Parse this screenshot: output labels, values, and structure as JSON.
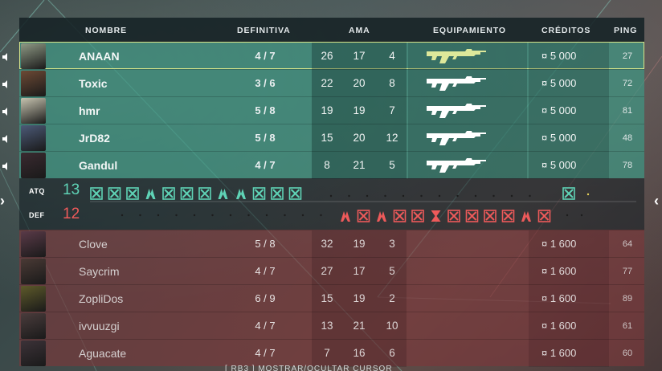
{
  "header": {
    "name": "NOMBRE",
    "ultimate": "DEFINITIVA",
    "kda": "AMA",
    "equipment": "EQUIPAMIENTO",
    "credits": "CRÉDITOS",
    "ping": "PING"
  },
  "attackers": [
    {
      "name": "ANAAN",
      "ultimate": "4 / 7",
      "kills": "26",
      "deaths": "17",
      "assists": "4",
      "credits": "¤ 5 000",
      "ping": "27",
      "weapon_color": "#dde89a",
      "avatar_color": "#8f9a85",
      "highlight": true
    },
    {
      "name": "Toxic",
      "ultimate": "3 / 6",
      "kills": "22",
      "deaths": "20",
      "assists": "8",
      "credits": "¤ 5 000",
      "ping": "72",
      "weapon_color": "#ffffff",
      "avatar_color": "#6d4a35",
      "highlight": false
    },
    {
      "name": "hmr",
      "ultimate": "5 / 8",
      "kills": "19",
      "deaths": "19",
      "assists": "7",
      "credits": "¤ 5 000",
      "ping": "81",
      "weapon_color": "#ffffff",
      "avatar_color": "#c7c4b0",
      "highlight": false
    },
    {
      "name": "JrD82",
      "ultimate": "5 / 8",
      "kills": "15",
      "deaths": "20",
      "assists": "12",
      "credits": "¤ 5 000",
      "ping": "48",
      "weapon_color": "#ffffff",
      "avatar_color": "#4c5a78",
      "highlight": false
    },
    {
      "name": "Gandul",
      "ultimate": "4 / 7",
      "kills": "8",
      "deaths": "21",
      "assists": "5",
      "credits": "¤ 5 000",
      "ping": "78",
      "weapon_color": "#ffffff",
      "avatar_color": "#3a2a30",
      "highlight": false
    }
  ],
  "defenders": [
    {
      "name": "Clove",
      "ultimate": "5 / 8",
      "kills": "32",
      "deaths": "19",
      "assists": "3",
      "credits": "¤ 1 600",
      "ping": "64",
      "avatar_color": "#5a3a48"
    },
    {
      "name": "Saycrim",
      "ultimate": "4 / 7",
      "kills": "27",
      "deaths": "17",
      "assists": "5",
      "credits": "¤ 1 600",
      "ping": "77",
      "avatar_color": "#4a3a35"
    },
    {
      "name": "ZopliDos",
      "ultimate": "6 / 9",
      "kills": "15",
      "deaths": "19",
      "assists": "2",
      "credits": "¤ 1 600",
      "ping": "89",
      "avatar_color": "#5e5a2a"
    },
    {
      "name": "ivvuuzgi",
      "ultimate": "4 / 7",
      "kills": "13",
      "deaths": "21",
      "assists": "10",
      "credits": "¤ 1 600",
      "ping": "61",
      "avatar_color": "#4a3c3c"
    },
    {
      "name": "Aguacate",
      "ultimate": "4 / 7",
      "kills": "7",
      "deaths": "16",
      "assists": "6",
      "credits": "¤ 1 600",
      "ping": "60",
      "avatar_color": "#3c3238"
    }
  ],
  "rounds": {
    "atk_label": "ATQ",
    "atk_score": "13",
    "def_label": "DEF",
    "def_score": "12",
    "atk_color": "#5fd3b6",
    "def_color": "#ee5a5a",
    "atk_history": [
      "elim",
      "elim",
      "elim",
      "defuse",
      "elim",
      "elim",
      "elim",
      "defuse",
      "defuse",
      "elim",
      "elim",
      "elim"
    ],
    "def_history": [
      "defuse",
      "elim",
      "defuse",
      "elim",
      "elim",
      "time",
      "elim",
      "elim",
      "elim",
      "elim",
      "defuse",
      "elim"
    ],
    "overtime_atk": "elim"
  },
  "footer": "[ RB3 ]   MOSTRAR/OCULTAR CURSOR",
  "icons": {
    "speaker": "speaker-icon",
    "weapon": "rifle-icon",
    "round_elim": "crossed-swords-icon",
    "round_defuse": "defuse-icon",
    "round_time": "hourglass-icon"
  }
}
